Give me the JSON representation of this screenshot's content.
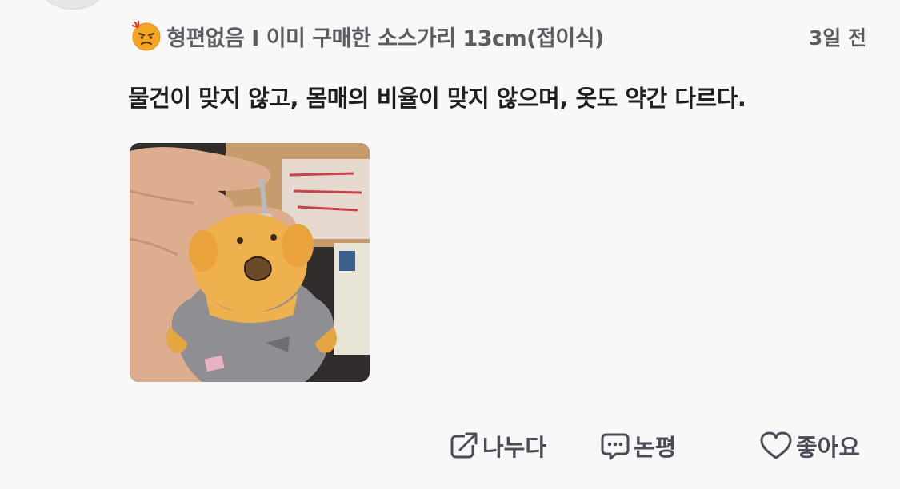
{
  "review": {
    "meta": "형편없음 I 이미 구매한 소스가리 13cm(접이식)",
    "rating_icon": "angry-face-icon",
    "time_ago": "3일 전",
    "body": "물건이 맞지 않고, 몸매의 비율이 맞지 않으며, 옷도 약간 다르다.",
    "photo_icon": "plush-keychain-photo"
  },
  "actions": {
    "share": {
      "label": "나누다",
      "icon": "share-icon"
    },
    "comment": {
      "label": "논평",
      "icon": "comment-icon"
    },
    "like": {
      "label": "좋아요",
      "icon": "heart-icon"
    }
  },
  "colors": {
    "background": "#f8f8f9",
    "meta_text": "#5c5c63",
    "body_text": "#1f1f22",
    "action_text": "#4b4c57",
    "emoji_face": "#f6a623",
    "emoji_mark": "#e8322d"
  }
}
